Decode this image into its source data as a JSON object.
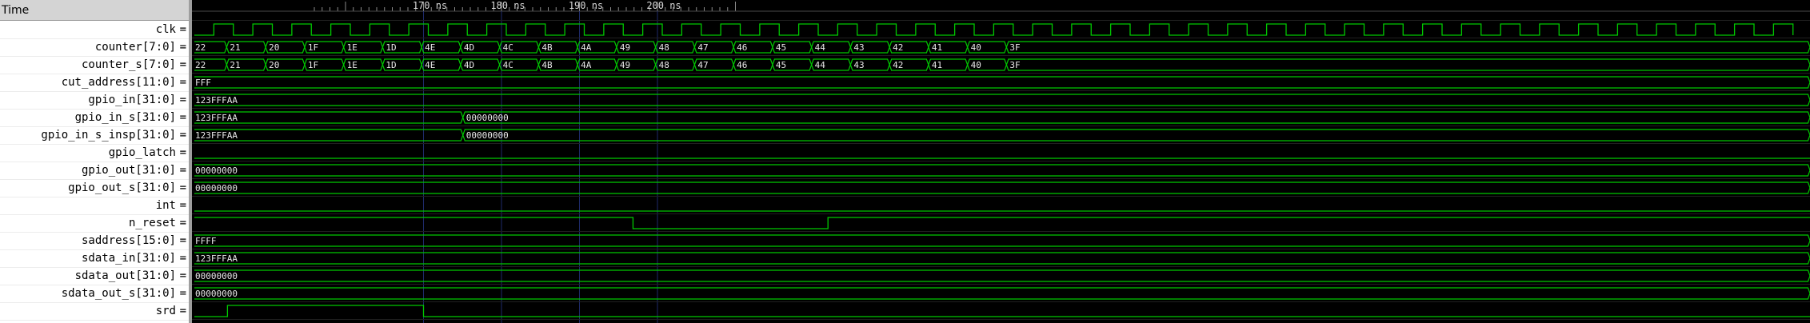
{
  "header": {
    "time_label": "Time"
  },
  "timeline": {
    "unit": "ns",
    "major": [
      170,
      180,
      190,
      200
    ],
    "labels": [
      "170 ns",
      "180 ns",
      "190 ns",
      "200 ns"
    ]
  },
  "signals": [
    {
      "name": "clk",
      "label": "clk",
      "type": "clock"
    },
    {
      "name": "counter",
      "label": "counter[7:0]",
      "type": "bus",
      "values": [
        "22",
        "21",
        "20",
        "1F",
        "1E",
        "1D",
        "4E",
        "4D",
        "4C",
        "4B",
        "4A",
        "49",
        "48",
        "47",
        "46",
        "45",
        "44",
        "43",
        "42",
        "41",
        "40",
        "3F"
      ]
    },
    {
      "name": "counter_s",
      "label": "counter_s[7:0]",
      "type": "bus",
      "values": [
        "22",
        "21",
        "20",
        "1F",
        "1E",
        "1D",
        "4E",
        "4D",
        "4C",
        "4B",
        "4A",
        "49",
        "48",
        "47",
        "46",
        "45",
        "44",
        "43",
        "42",
        "41",
        "40",
        "3F"
      ]
    },
    {
      "name": "cut_address",
      "label": "cut_address[11:0]",
      "type": "bus",
      "values": [
        "FFF"
      ]
    },
    {
      "name": "gpio_in",
      "label": "gpio_in[31:0]",
      "type": "bus",
      "values": [
        "123FFFAA"
      ]
    },
    {
      "name": "gpio_in_s",
      "label": "gpio_in_s[31:0]",
      "type": "bus",
      "values": [
        "123FFFAA",
        "00000000"
      ]
    },
    {
      "name": "gpio_in_s_insp",
      "label": "gpio_in_s_insp[31:0]",
      "type": "bus",
      "values": [
        "123FFFAA",
        "00000000"
      ]
    },
    {
      "name": "gpio_latch",
      "label": "gpio_latch",
      "type": "bit",
      "level": "low"
    },
    {
      "name": "gpio_out",
      "label": "gpio_out[31:0]",
      "type": "bus",
      "values": [
        "00000000"
      ]
    },
    {
      "name": "gpio_out_s",
      "label": "gpio_out_s[31:0]",
      "type": "bus",
      "values": [
        "00000000"
      ]
    },
    {
      "name": "int",
      "label": "int",
      "type": "bit",
      "level": "low"
    },
    {
      "name": "n_reset",
      "label": "n_reset",
      "type": "bit",
      "level": "high",
      "low_pulse": [
        1,
        2
      ]
    },
    {
      "name": "saddress",
      "label": "saddress[15:0]",
      "type": "bus",
      "values": [
        "FFFF"
      ]
    },
    {
      "name": "sdata_in",
      "label": "sdata_in[31:0]",
      "type": "bus",
      "values": [
        "123FFFAA"
      ]
    },
    {
      "name": "sdata_out",
      "label": "sdata_out[31:0]",
      "type": "bus",
      "values": [
        "00000000"
      ]
    },
    {
      "name": "sdata_out_s",
      "label": "sdata_out_s[31:0]",
      "type": "bus",
      "values": [
        "00000000"
      ]
    },
    {
      "name": "srd",
      "label": "srd",
      "type": "bit",
      "level": "low",
      "high_pulse": [
        0,
        1
      ]
    }
  ],
  "colors": {
    "trace": "#00c800",
    "grid": "#1e2a6a",
    "background": "#000000",
    "tick_label": "#d8d8d8"
  }
}
